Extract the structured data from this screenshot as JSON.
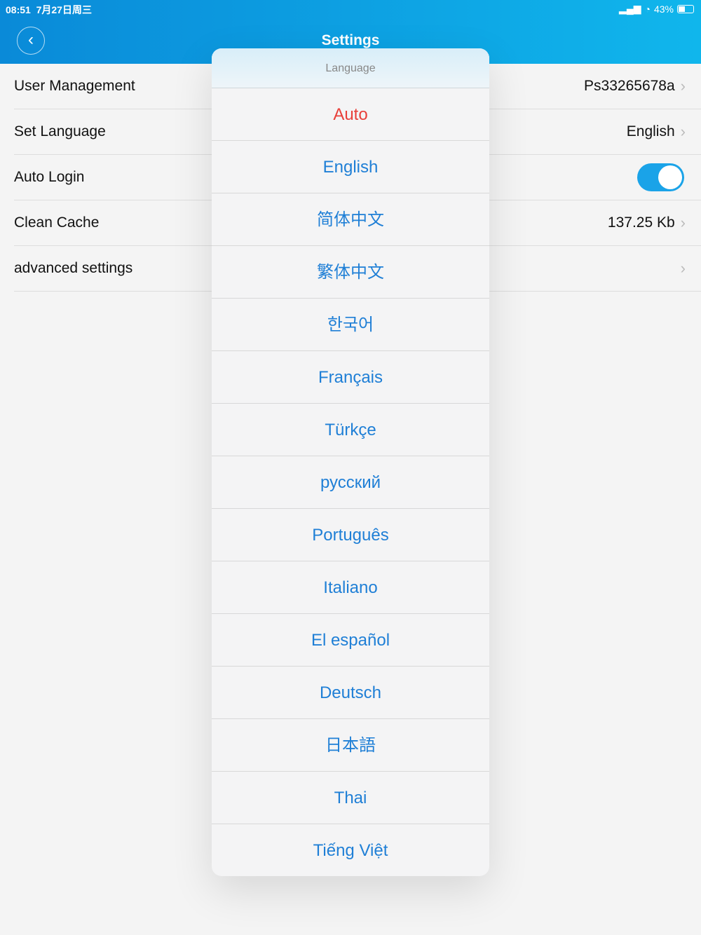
{
  "status_bar": {
    "time": "08:51",
    "date": "7月27日周三",
    "battery": "43%"
  },
  "header": {
    "title": "Settings"
  },
  "settings": [
    {
      "label": "User Management",
      "value": "Ps33265678a"
    },
    {
      "label": "Set Language",
      "value": "English"
    },
    {
      "label": "Auto Login",
      "toggle": true
    },
    {
      "label": "Clean Cache",
      "value": "137.25 Kb"
    },
    {
      "label": "advanced settings",
      "value": ""
    }
  ],
  "language_popup": {
    "title": "Language",
    "selected": "Auto",
    "options": [
      "Auto",
      "English",
      "简体中文",
      "繁体中文",
      "한국어",
      "Français",
      "Türkçe",
      "русский",
      "Português",
      "Italiano",
      "El español",
      "Deutsch",
      "日本語",
      "Thai",
      "Tiếng Việt"
    ]
  },
  "colors": {
    "accent": "#1aa3e8",
    "selected": "#e8403a",
    "option": "#1f7fd6"
  }
}
